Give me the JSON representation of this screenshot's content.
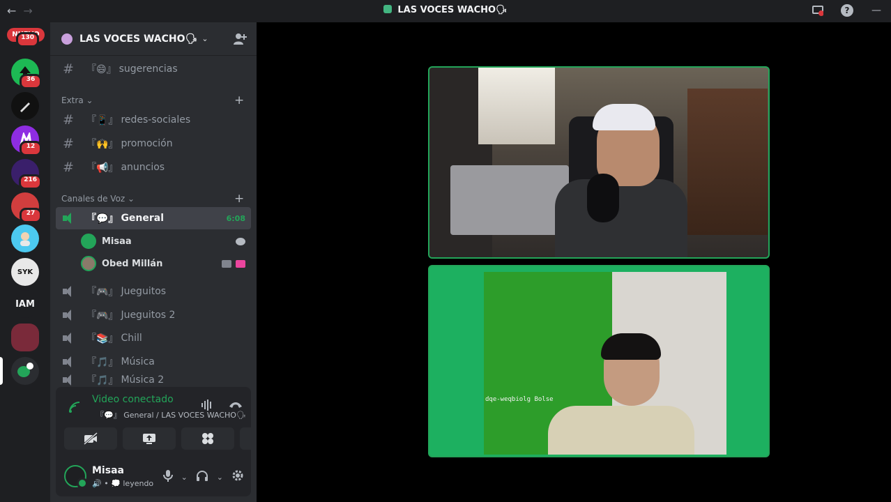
{
  "titlebar": {
    "back": "←",
    "forward": "→",
    "title": "LAS VOCES WACHO🗣",
    "icons": [
      "screen-share-status-icon",
      "help-icon",
      "minimize-icon"
    ],
    "help_glyph": "?",
    "minimize_glyph": "—"
  },
  "servers": {
    "new_label": "NUEVO",
    "items": [
      {
        "name": "server-1",
        "badge": "130",
        "color": "#5865f2"
      },
      {
        "name": "server-2",
        "badge": "36",
        "color": "#1db954"
      },
      {
        "name": "server-3",
        "badge": "",
        "color": "#111111"
      },
      {
        "name": "server-4",
        "badge": "12",
        "color": "#8e2de2"
      },
      {
        "name": "server-5",
        "badge": "216",
        "color": "#3a1f6b"
      },
      {
        "name": "server-6",
        "badge": "27",
        "color": "#d13e3e"
      },
      {
        "name": "server-7",
        "badge": "",
        "color": "#4cc9f0"
      },
      {
        "name": "server-8",
        "label": "SYK",
        "badge": "",
        "color": "#e8e8e8"
      },
      {
        "name": "server-9",
        "label": "IAM",
        "badge": "",
        "color": "#1e1f22"
      },
      {
        "name": "server-10",
        "badge": "",
        "color": "#7a2a3a"
      },
      {
        "name": "server-11",
        "badge": "",
        "color": "#23a559"
      }
    ]
  },
  "guild": {
    "name": "LAS VOCES WACHO🗣",
    "chevron": "⌄",
    "invite_glyph": "👤+"
  },
  "text_channels": [
    {
      "label": "sugerencias",
      "emoji": "『😄』"
    }
  ],
  "category_extra": {
    "label": "Extra",
    "chevron": "⌄",
    "plus": "+"
  },
  "extra_channels": [
    {
      "label": "redes-sociales",
      "emoji": "『📱』"
    },
    {
      "label": "promoción",
      "emoji": "『🙌』"
    },
    {
      "label": "anuncios",
      "emoji": "『📢』"
    }
  ],
  "category_voice": {
    "label": "Canales de Voz",
    "chevron": "⌄",
    "plus": "+"
  },
  "voice_active": {
    "label": "General",
    "emoji": "『💬』",
    "time": "6:08"
  },
  "voice_members": [
    {
      "name": "Misaa"
    },
    {
      "name": "Obed Millán"
    }
  ],
  "voice_channels": [
    {
      "label": "Jueguitos",
      "emoji": "『🎮』"
    },
    {
      "label": "Jueguitos 2",
      "emoji": "『🎮』"
    },
    {
      "label": "Chill",
      "emoji": "『📚』"
    },
    {
      "label": "Música",
      "emoji": "『🎵』"
    },
    {
      "label": "Música 2",
      "emoji": "『🎵』"
    }
  ],
  "voice_panel": {
    "status": "Video conectado",
    "sub": "『💬』 General / LAS VOCES WACHO🗣",
    "buttons": [
      "camera-off-icon",
      "screen-share-icon",
      "activities-icon",
      "soundboard-icon"
    ]
  },
  "user": {
    "name": "Misaa",
    "status": "🔊 • 💭 leyendo"
  },
  "video_tiles": {
    "tile_2_text": "dqe-weqbiolg Bolse"
  }
}
